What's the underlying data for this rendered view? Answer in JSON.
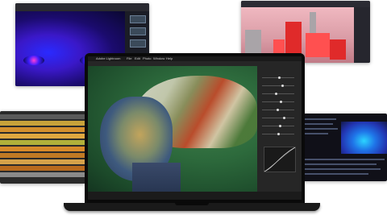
{
  "laptop_app": {
    "menu": [
      "Adobe Lightroom",
      "File",
      "Edit",
      "Photo",
      "Window",
      "Help"
    ],
    "document_title": "",
    "toolbar_zoom": ""
  },
  "colors": {
    "accent": "#e02a2a",
    "viz": "#2bd4ff",
    "node_editor": "#3a18c8"
  },
  "icons": [
    "apple-icon",
    "chevron-icon",
    "slider-knob-icon"
  ]
}
